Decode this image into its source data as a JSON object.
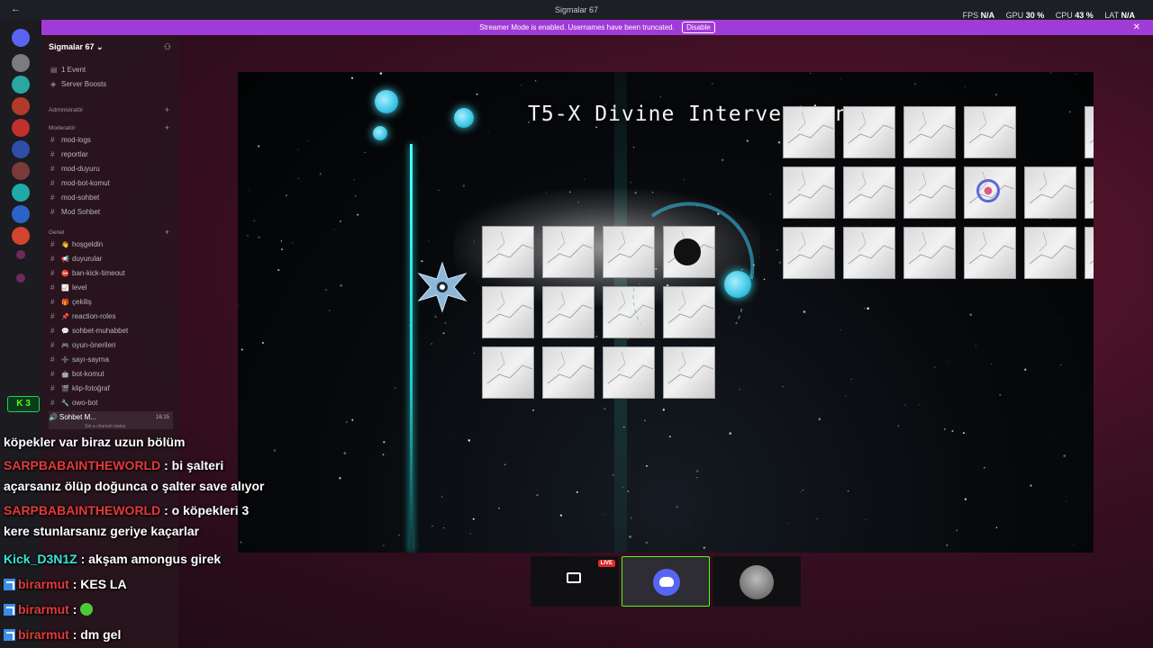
{
  "window": {
    "title": "Sigmalar 67",
    "stats": {
      "fps_label": "FPS",
      "fps_value": "N/A",
      "gpu_label": "GPU",
      "gpu_value": "30 %",
      "cpu_label": "CPU",
      "cpu_value": "43 %",
      "lat_label": "LAT",
      "lat_value": "N/A"
    }
  },
  "banner": {
    "text": "Streamer Mode is enabled. Usernames have been truncated.",
    "disable_label": "Disable"
  },
  "sidebar": {
    "server_name": "Sigmalar 67 ⌄",
    "top_items": [
      {
        "icon": "calendar-icon",
        "glyph": "▤",
        "label": "1 Event"
      },
      {
        "icon": "boost-icon",
        "glyph": "◈",
        "label": "Server Boosts"
      }
    ],
    "categories": {
      "admin": "Administratör",
      "mod": "Moderatör",
      "general": "Genel"
    },
    "mod_channels": [
      "mod-logs",
      "reportlar",
      "mod-duyuru",
      "mod-bot-komut",
      "mod-sohbet",
      "Mod Sohbet"
    ],
    "general_channels": [
      {
        "emoji": "👋",
        "label": "hoşgeldin"
      },
      {
        "emoji": "📢",
        "label": "duyurular"
      },
      {
        "emoji": "⛔",
        "label": "ban-kick-timeout"
      },
      {
        "emoji": "📈",
        "label": "level"
      },
      {
        "emoji": "🎁",
        "label": "çekiliş"
      },
      {
        "emoji": "📌",
        "label": "reaction-roles"
      },
      {
        "emoji": "💬",
        "label": "sohbet-muhabbet"
      },
      {
        "emoji": "🎮",
        "label": "oyun-önerileri"
      },
      {
        "emoji": "➕",
        "label": "sayı-sayma"
      },
      {
        "emoji": "🤖",
        "label": "bot-komut"
      },
      {
        "emoji": "🎬",
        "label": "klip-fotoğraf"
      },
      {
        "emoji": "🔧",
        "label": "owo-bot"
      }
    ],
    "voice_channel": {
      "label": "Sohbet M...",
      "time": "16:15",
      "status": "Set a channel status"
    },
    "kick_count": "3"
  },
  "game": {
    "level_title": "T5-X Divine Intervention"
  },
  "chat": [
    {
      "user": "",
      "text": "köpekler var biraz uzun bölüm",
      "color": "white",
      "kick": false
    },
    {
      "user": "SARPBABAINTHEWORLD",
      "text": ": bi şalteri açarsanız ölüp doğunca o şalter save alıyor",
      "color": "red",
      "kick": false
    },
    {
      "user": "SARPBABAINTHEWORLD",
      "text": ": o köpekleri 3 kere stunlarsanız geriye kaçarlar",
      "color": "red",
      "kick": false
    },
    {
      "user": "Kick_D3N1Z",
      "text": ": akşam amongus girek",
      "color": "cyan",
      "kick": false
    },
    {
      "user": "birarmut",
      "text": ": KES LA",
      "color": "red",
      "kick": true
    },
    {
      "user": "birarmut",
      "text": ":",
      "color": "red",
      "kick": true,
      "emote": "green-emote-icon"
    },
    {
      "user": "birarmut",
      "text": ": dm gel",
      "color": "red",
      "kick": true
    }
  ],
  "stream_tiles": [
    {
      "name": "screen-share-tile",
      "live": "LIVE"
    },
    {
      "name": "discord-tile",
      "live": ""
    },
    {
      "name": "user-avatar-tile",
      "live": ""
    }
  ],
  "colors": {
    "accent": "#a13bd8",
    "kick_green": "#53fc18",
    "beam": "#2ee6e6"
  }
}
